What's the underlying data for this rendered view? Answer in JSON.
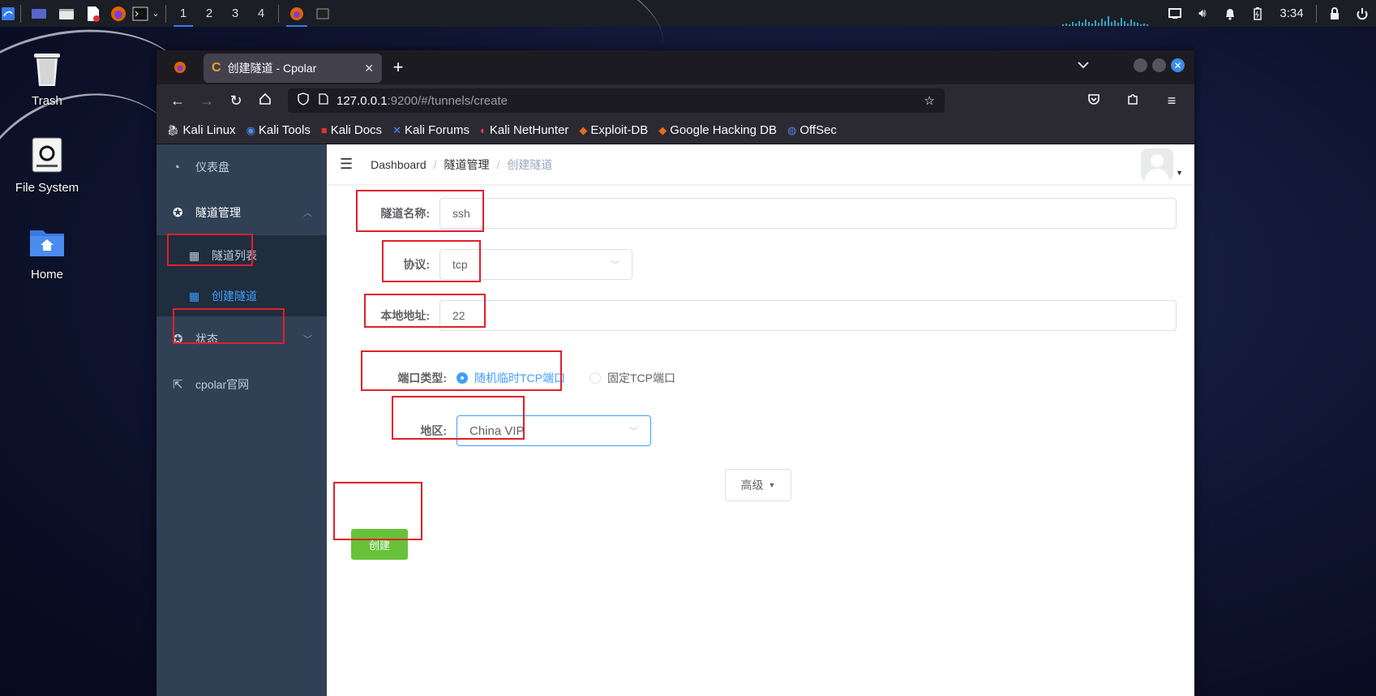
{
  "panel": {
    "workspaces": [
      "1",
      "2",
      "3",
      "4"
    ],
    "active_workspace": "1",
    "clock": "3:34",
    "accent": "#367bf0"
  },
  "desktop": {
    "icons": [
      {
        "label": "Trash",
        "icon": "trash-icon"
      },
      {
        "label": "File System",
        "icon": "drive-icon"
      },
      {
        "label": "Home",
        "icon": "home-folder-icon"
      }
    ]
  },
  "browser": {
    "tab_title": "创建隧道 - Cpolar",
    "tab_favicon": "C",
    "url_host": "127.0.0.1",
    "url_rest": ":9200/#/tunnels/create",
    "bookmarks": [
      {
        "label": "Kali Linux",
        "icon": "kali-dragon-icon"
      },
      {
        "label": "Kali Tools",
        "icon": "kali-tools-icon"
      },
      {
        "label": "Kali Docs",
        "icon": "kali-docs-icon"
      },
      {
        "label": "Kali Forums",
        "icon": "kali-forums-icon"
      },
      {
        "label": "Kali NetHunter",
        "icon": "nethunter-icon"
      },
      {
        "label": "Exploit-DB",
        "icon": "exploit-db-icon"
      },
      {
        "label": "Google Hacking DB",
        "icon": "ghdb-icon"
      },
      {
        "label": "OffSec",
        "icon": "offsec-icon"
      }
    ]
  },
  "sidebar": {
    "dashboard": "仪表盘",
    "tunnel_mgmt": "隧道管理",
    "tunnel_list": "隧道列表",
    "create_tunnel": "创建隧道",
    "status": "状态",
    "website": "cpolar官网",
    "bg": "#304156",
    "active_color": "#409eff"
  },
  "breadcrumb": {
    "items": [
      "Dashboard",
      "隧道管理",
      "创建隧道"
    ],
    "sep": "/"
  },
  "form": {
    "name_label": "隧道名称:",
    "name_value": "ssh",
    "protocol_label": "协议:",
    "protocol_value": "tcp",
    "local_addr_label": "本地地址:",
    "local_addr_value": "22",
    "port_type_label": "端口类型:",
    "port_options": [
      "随机临时TCP端口",
      "固定TCP端口"
    ],
    "port_selected": "随机临时TCP端口",
    "region_label": "地区:",
    "region_value": "China VIP",
    "advanced_label": "高级",
    "create_label": "创建",
    "create_color": "#67c23a"
  }
}
